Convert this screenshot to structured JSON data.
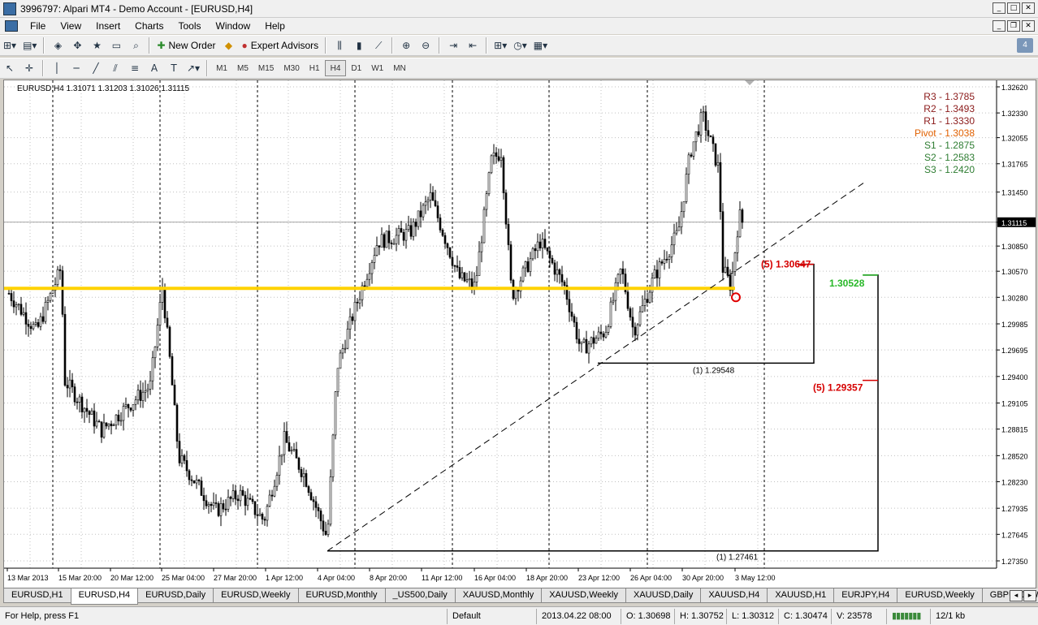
{
  "window": {
    "title": "3996797: Alpari MT4 - Demo Account - [EURUSD,H4]"
  },
  "menu": [
    "File",
    "View",
    "Insert",
    "Charts",
    "Tools",
    "Window",
    "Help"
  ],
  "toolbar": {
    "new_order": "New Order",
    "expert_advisors": "Expert Advisors",
    "timeframes": [
      "M1",
      "M5",
      "M15",
      "M30",
      "H1",
      "H4",
      "D1",
      "W1",
      "MN"
    ],
    "active_timeframe": "H4"
  },
  "chart": {
    "info": "EURUSD,H4  1.31071 1.31203 1.31026 1.31115",
    "pivots": [
      {
        "label": "R3 - 1.3785",
        "color": "#8b1a1a"
      },
      {
        "label": "R2 - 1.3493",
        "color": "#8b1a1a"
      },
      {
        "label": "R1 - 1.3330",
        "color": "#8b1a1a"
      },
      {
        "label": "Pivot - 1.3038",
        "color": "#e06000"
      },
      {
        "label": "S1 - 1.2875",
        "color": "#2e7d32"
      },
      {
        "label": "S2 - 1.2583",
        "color": "#2e7d32"
      },
      {
        "label": "S3 - 1.2420",
        "color": "#2e7d32"
      }
    ],
    "price_axis": [
      "1.32620",
      "1.32330",
      "1.32055",
      "1.31765",
      "1.31450",
      "1.31115",
      "1.30850",
      "1.30570",
      "1.30280",
      "1.29985",
      "1.29695",
      "1.29400",
      "1.29105",
      "1.28815",
      "1.28520",
      "1.28230",
      "1.27935",
      "1.27645",
      "1.27350"
    ],
    "current_price": "1.31115",
    "time_axis": [
      "13 Mar 2013",
      "15 Mar 20:00",
      "20 Mar 12:00",
      "25 Mar 04:00",
      "27 Mar 20:00",
      "1 Apr 12:00",
      "4 Apr 04:00",
      "8 Apr 20:00",
      "11 Apr 12:00",
      "16 Apr 04:00",
      "18 Apr 20:00",
      "23 Apr 12:00",
      "26 Apr 04:00",
      "30 Apr 20:00",
      "3 May 12:00"
    ],
    "annotations": {
      "target1": "(5) 1.30647",
      "target2": "1.30528",
      "target3": "(5) 1.29357",
      "low1": "(1) 1.29548",
      "low2": "(1) 1.27461"
    },
    "colors": {
      "pivot_line": "#ffd200",
      "target_red": "#d60000",
      "target_green": "#28b828",
      "circle": "#e00000"
    }
  },
  "tabs": [
    "EURUSD,H1",
    "EURUSD,H4",
    "EURUSD,Daily",
    "EURUSD,Weekly",
    "EURUSD,Monthly",
    "_US500,Daily",
    "XAUUSD,Monthly",
    "XAUUSD,Weekly",
    "XAUUSD,Daily",
    "XAUUSD,H4",
    "XAUUSD,H1",
    "EURJPY,H4",
    "EURUSD,Weekly",
    "GBPUSD,W"
  ],
  "active_tab": "EURUSD,H4",
  "status": {
    "help": "For Help, press F1",
    "profile": "Default",
    "time": "2013.04.22 08:00",
    "open": "O: 1.30698",
    "high": "H: 1.30752",
    "low": "L: 1.30312",
    "close": "C: 1.30474",
    "volume": "V: 23578",
    "traffic": "12/1 kb"
  }
}
